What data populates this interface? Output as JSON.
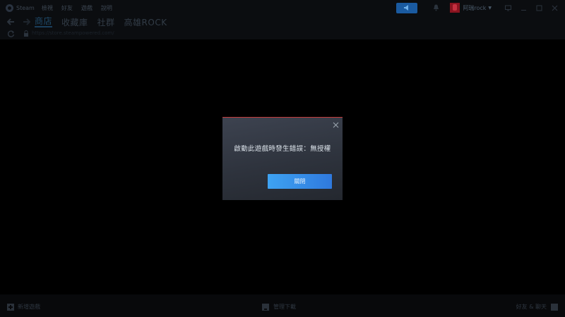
{
  "menu": {
    "app_name": "Steam",
    "items": [
      "檢視",
      "好友",
      "遊戲",
      "說明"
    ]
  },
  "topbar": {
    "user_name": "阿瑞rock",
    "icons": [
      "announcement-icon",
      "bell-icon",
      "chevron-down-icon",
      "monitor-icon",
      "minimize-icon",
      "maximize-icon",
      "close-icon"
    ]
  },
  "nav": {
    "tabs": [
      {
        "label": "商店",
        "active": true
      },
      {
        "label": "收藏庫",
        "active": false
      },
      {
        "label": "社群",
        "active": false
      },
      {
        "label": "高雄ROCK",
        "active": false
      }
    ]
  },
  "urlbar": {
    "url": "https://store.steampowered.com/"
  },
  "dialog": {
    "message": "啟動此遊戲時發生錯誤：無授權",
    "button_label": "關閉",
    "accent_color": "#c53b3b"
  },
  "bottombar": {
    "add_game": "新增遊戲",
    "downloads": "管理下載",
    "friends_chat": "好友 & 聊天"
  },
  "colors": {
    "primary_button": "#2f79dd",
    "background": "#000000"
  }
}
